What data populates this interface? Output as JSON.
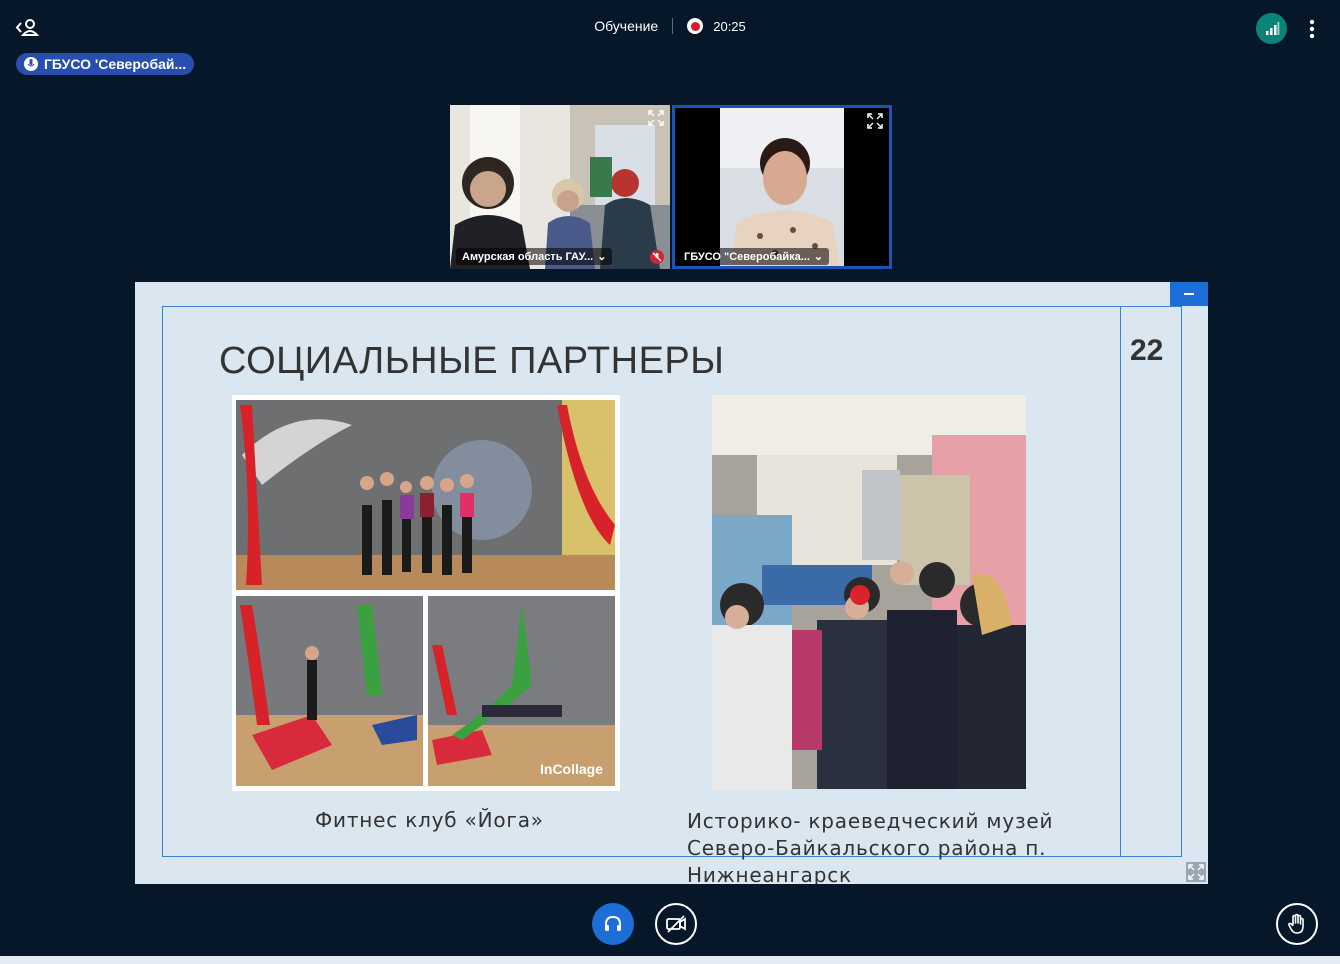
{
  "header": {
    "meeting_title": "Обучение",
    "recording_time": "20:25",
    "talking_indicator": "ГБУСО 'Северобай..."
  },
  "videos": [
    {
      "label": "Амурская область ГАУ...",
      "muted": true
    },
    {
      "label": "ГБУСО \"Северобайка...",
      "muted": false
    }
  ],
  "slide": {
    "title": "СОЦИАЛЬНЫЕ ПАРТНЕРЫ",
    "number": "22",
    "caption_left": "Фитнес клуб «Йога»",
    "caption_right": "Историко- краеведческий музей Северо-Байкальского района п. Нижнеангарск",
    "collage_watermark": "InCollage"
  },
  "colors": {
    "background": "#06172a",
    "accent": "#1d6fd6",
    "record": "#e0162b",
    "connection": "#0c8378",
    "slide_bg": "#dae6f0"
  },
  "icons": {
    "users": "users-icon",
    "record": "record-icon",
    "connection": "signal-bars-icon",
    "more": "kebab-menu-icon",
    "audio": "headphones-icon",
    "camera": "camera-off-icon",
    "hand": "raise-hand-icon"
  }
}
